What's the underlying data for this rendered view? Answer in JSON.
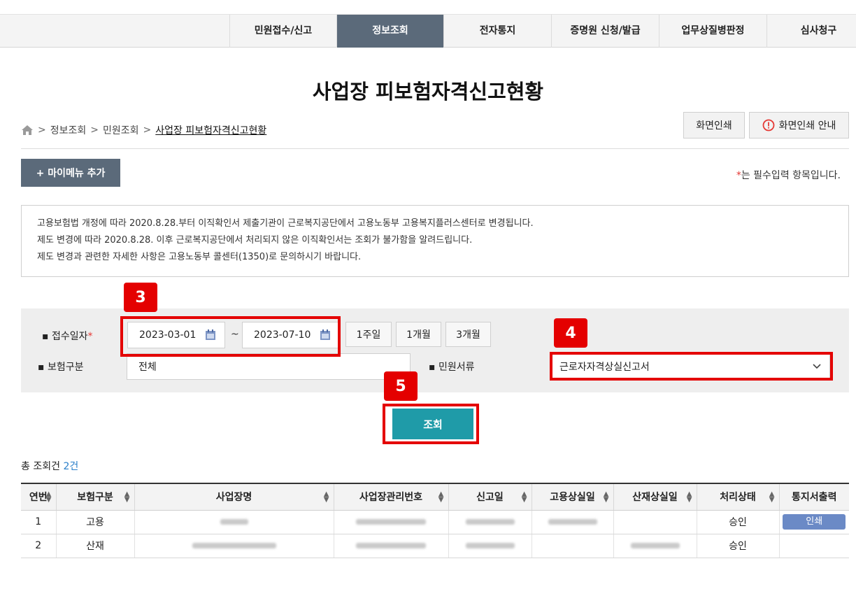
{
  "nav": {
    "items": [
      {
        "label": "민원접수/신고"
      },
      {
        "label": "정보조회"
      },
      {
        "label": "전자통지"
      },
      {
        "label": "증명원 신청/발급"
      },
      {
        "label": "업무상질병판정"
      },
      {
        "label": "심사청구"
      }
    ],
    "active_index": 1
  },
  "page": {
    "title": "사업장 피보험자격신고현황",
    "breadcrumb": [
      "정보조회",
      "민원조회",
      "사업장 피보험자격신고현황"
    ],
    "print_label": "화면인쇄",
    "print_guide_label": "화면인쇄 안내",
    "mymenu_label": "+ 마이메뉴 추가",
    "required_note": "는 필수입력 항목입니다.",
    "required_star": "*"
  },
  "notice": {
    "lines": [
      "고용보험법 개정에 따라 2020.8.28.부터 이직확인서 제출기관이 근로복지공단에서 고용노동부 고용복지플러스센터로 변경됩니다.",
      "제도 변경에 따라 2020.8.28. 이후 근로복지공단에서 처리되지 않은 이직확인서는 조회가 불가함을 알려드립니다.",
      "제도 변경과 관련한 자세한 사항은 고용노동부 콜센터(1350)로 문의하시기 바랍니다."
    ]
  },
  "search": {
    "date_label": "접수일자",
    "date_from": "2023-03-01",
    "date_to": "2023-07-10",
    "tilde": "~",
    "periods": [
      "1주일",
      "1개월",
      "3개월"
    ],
    "insurance_label": "보험구분",
    "insurance_value": "전체",
    "doc_label": "민원서류",
    "doc_value": "근로자자격상실신고서",
    "search_button": "조회"
  },
  "annotations": {
    "badge3": "3",
    "badge4": "4",
    "badge5": "5"
  },
  "result": {
    "count_prefix": "총 조회건",
    "count_value": "2건",
    "headers": [
      "연번",
      "보험구분",
      "사업장명",
      "사업장관리번호",
      "신고일",
      "고용상실일",
      "산재상실일",
      "처리상태",
      "통지서출력"
    ],
    "rows": [
      {
        "no": "1",
        "type": "고용",
        "status": "승인",
        "print": "인쇄"
      },
      {
        "no": "2",
        "type": "산재",
        "status": "승인",
        "print": ""
      }
    ]
  },
  "colors": {
    "nav_active": "#5b6a7a",
    "search_button": "#1f9ba8",
    "annotation_red": "#e40000",
    "count_blue": "#2a7fc9"
  }
}
